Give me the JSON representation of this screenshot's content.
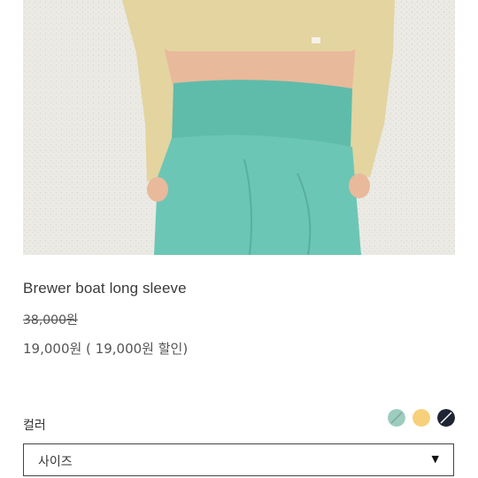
{
  "product": {
    "name": "Brewer boat long sleeve",
    "original_price": "38,000원",
    "sale_price": "19,000원 ( 19,000원 할인)",
    "photo": {
      "top_color": "#e3d4a0",
      "pants_color": "#6cc6b5",
      "background_color": "#ebeae4",
      "skin_color": "#e8b99b"
    }
  },
  "options": {
    "color_label": "컬러",
    "color_swatches": [
      {
        "name": "mint",
        "color": "#9ccdbf",
        "slash": "#7aa89b"
      },
      {
        "name": "yellow",
        "color": "#f7d07a",
        "slash": ""
      },
      {
        "name": "navy",
        "color": "#1e2433",
        "slash": "#ffffff"
      }
    ],
    "size_select_label": "사이즈",
    "size_select_arrow": "▼"
  }
}
